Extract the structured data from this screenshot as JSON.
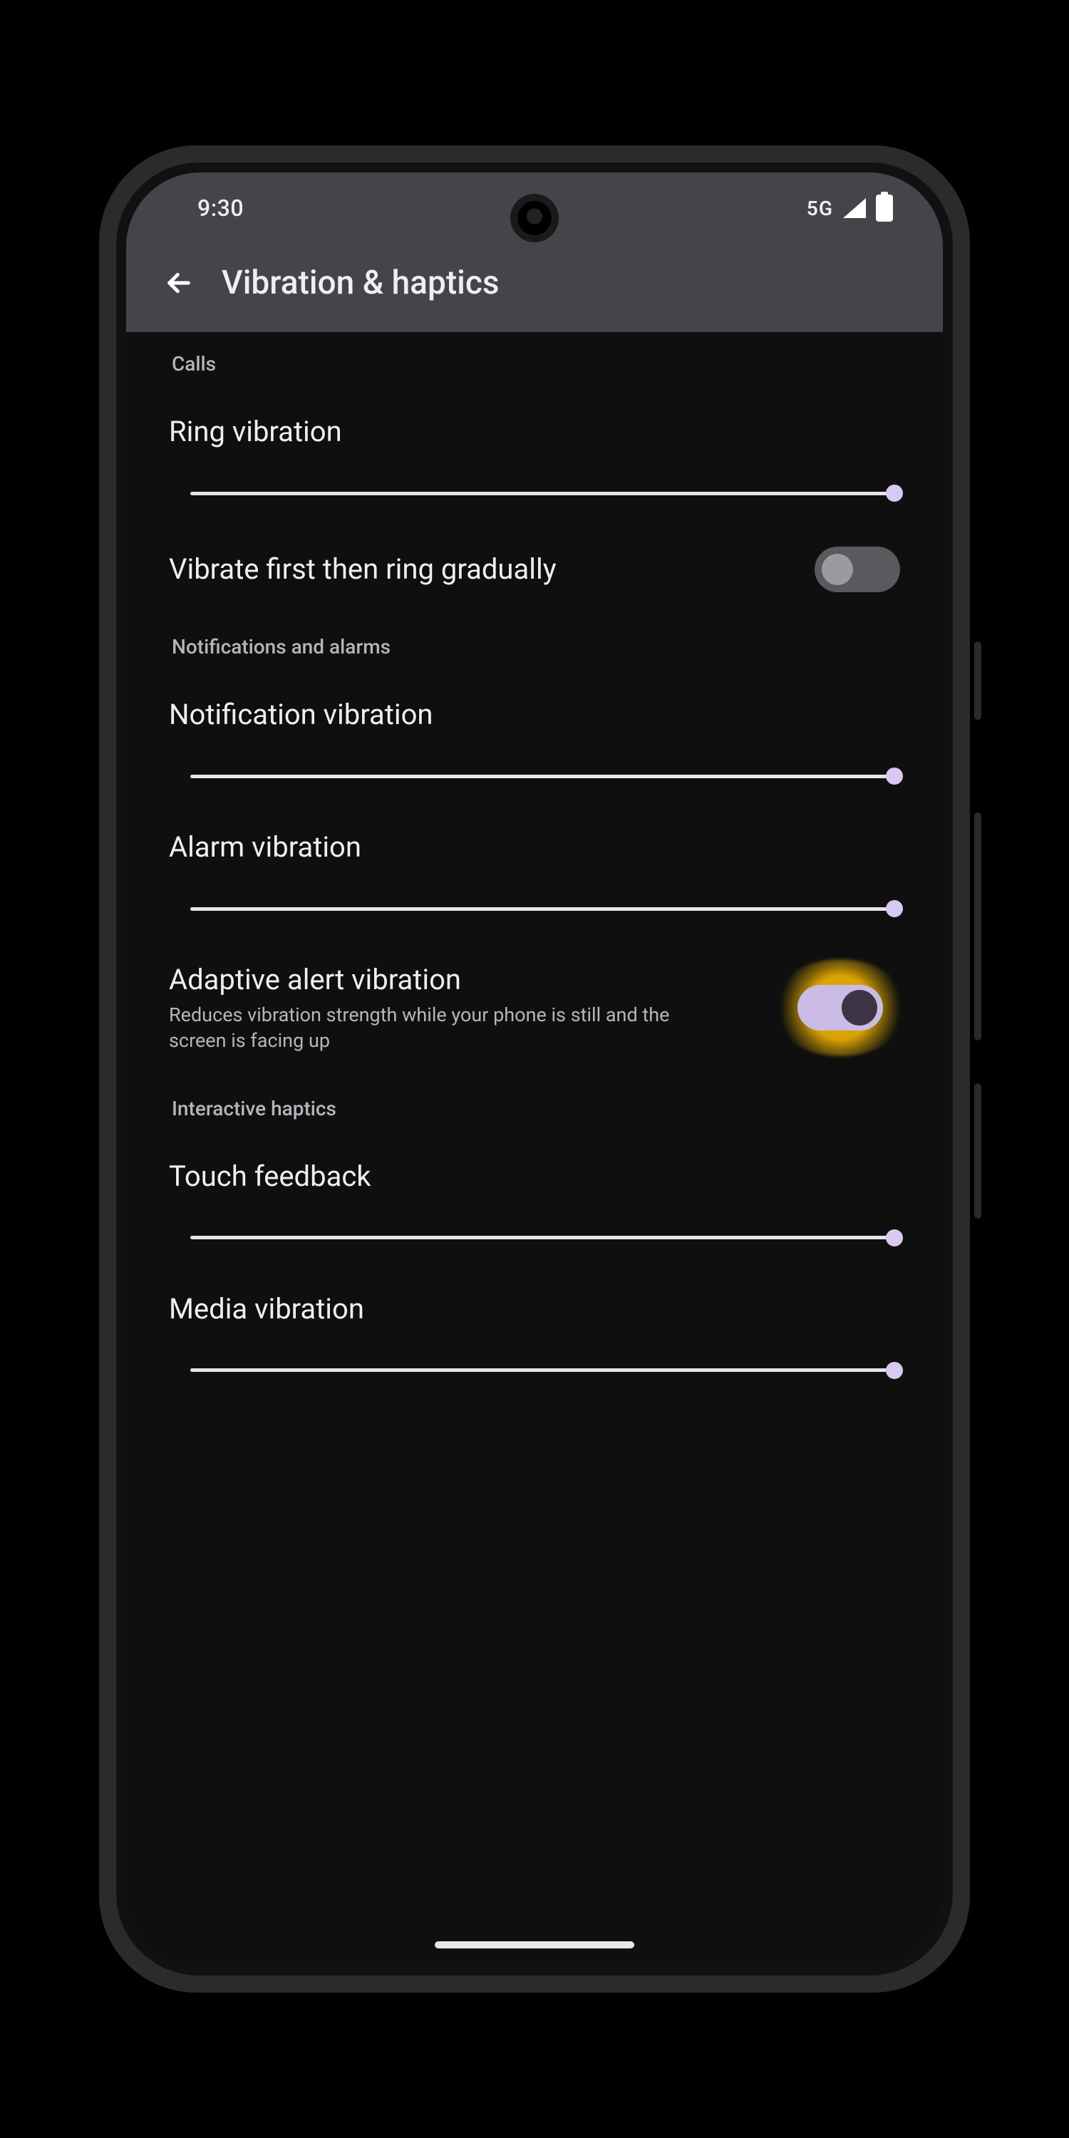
{
  "status": {
    "time": "9:30",
    "network": "5G"
  },
  "header": {
    "title": "Vibration & haptics"
  },
  "sections": {
    "calls": {
      "label": "Calls",
      "ring_vibration": {
        "title": "Ring vibration",
        "value_pct": 100
      },
      "vibrate_first": {
        "title": "Vibrate first then ring gradually",
        "enabled": false
      }
    },
    "notif": {
      "label": "Notifications and alarms",
      "notification_vibration": {
        "title": "Notification vibration",
        "value_pct": 100
      },
      "alarm_vibration": {
        "title": "Alarm vibration",
        "value_pct": 100
      },
      "adaptive": {
        "title": "Adaptive alert vibration",
        "subtitle": "Reduces vibration strength while your phone is still and the screen is facing up",
        "enabled": true,
        "highlighted": true
      }
    },
    "interactive": {
      "label": "Interactive haptics",
      "touch_feedback": {
        "title": "Touch feedback",
        "value_pct": 100
      },
      "media_vibration": {
        "title": "Media vibration",
        "value_pct": 100
      }
    }
  },
  "colors": {
    "highlight": "#f0b400",
    "accent": "#d7c9ef",
    "topbar_bg": "#46434a",
    "screen_bg": "#0f0f10"
  }
}
